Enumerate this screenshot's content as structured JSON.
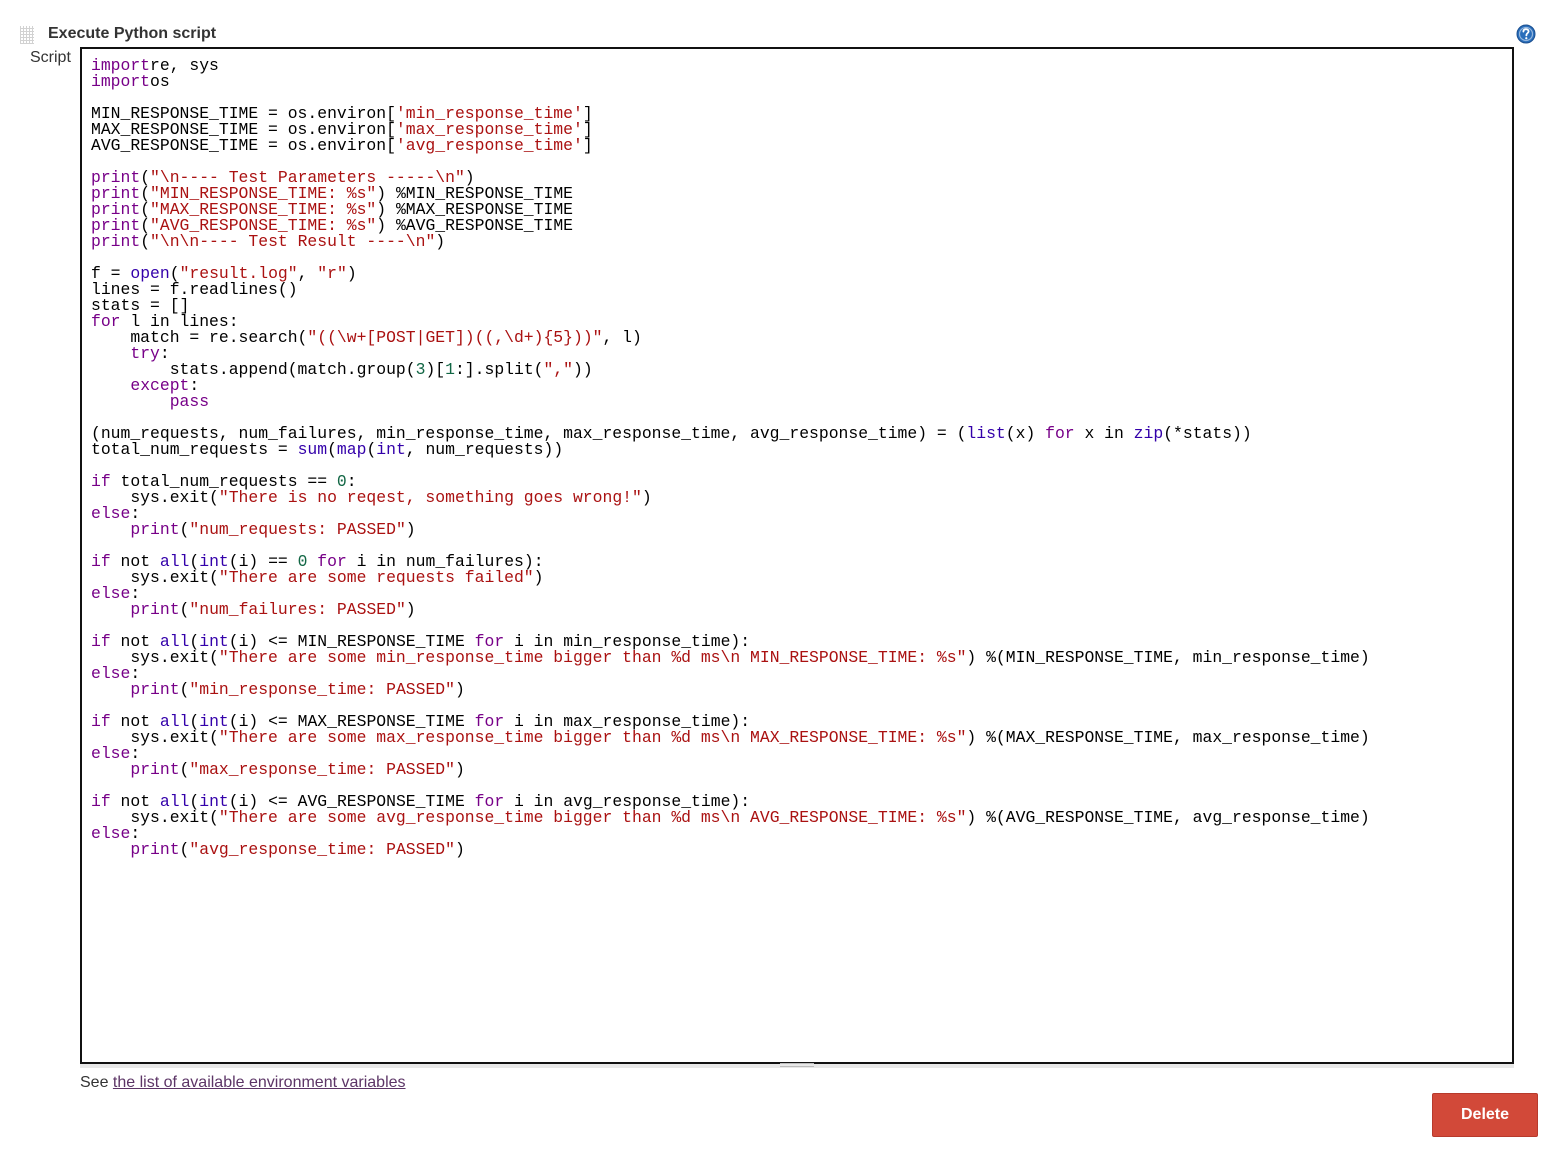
{
  "section": {
    "title": "Execute Python script",
    "help_icon": "question-circle-icon"
  },
  "field": {
    "label": "Script"
  },
  "code": {
    "lines": [
      [
        [
          "kw",
          "import"
        ],
        [
          "",
          "re, sys"
        ]
      ],
      [
        [
          "kw",
          "import"
        ],
        [
          "",
          "os"
        ]
      ],
      [],
      [
        [
          "",
          "MIN_RESPONSE_TIME = os.environ["
        ],
        [
          "str",
          "'min_response_time'"
        ],
        [
          "",
          "]"
        ]
      ],
      [
        [
          "",
          "MAX_RESPONSE_TIME = os.environ["
        ],
        [
          "str",
          "'max_response_time'"
        ],
        [
          "",
          "]"
        ]
      ],
      [
        [
          "",
          "AVG_RESPONSE_TIME = os.environ["
        ],
        [
          "str",
          "'avg_response_time'"
        ],
        [
          "",
          "]"
        ]
      ],
      [],
      [
        [
          "kw",
          "print"
        ],
        [
          "",
          "("
        ],
        [
          "str",
          "\"\\n---- Test Parameters -----\\n\""
        ],
        [
          "",
          ")"
        ]
      ],
      [
        [
          "kw",
          "print"
        ],
        [
          "",
          "("
        ],
        [
          "str",
          "\"MIN_RESPONSE_TIME: %s\""
        ],
        [
          "",
          ") %MIN_RESPONSE_TIME"
        ]
      ],
      [
        [
          "kw",
          "print"
        ],
        [
          "",
          "("
        ],
        [
          "str",
          "\"MAX_RESPONSE_TIME: %s\""
        ],
        [
          "",
          ") %MAX_RESPONSE_TIME"
        ]
      ],
      [
        [
          "kw",
          "print"
        ],
        [
          "",
          "("
        ],
        [
          "str",
          "\"AVG_RESPONSE_TIME: %s\""
        ],
        [
          "",
          ") %AVG_RESPONSE_TIME"
        ]
      ],
      [
        [
          "kw",
          "print"
        ],
        [
          "",
          "("
        ],
        [
          "str",
          "\"\\n\\n---- Test Result ----\\n\""
        ],
        [
          "",
          ")"
        ]
      ],
      [],
      [
        [
          "",
          "f = "
        ],
        [
          "bi",
          "open"
        ],
        [
          "",
          "("
        ],
        [
          "str",
          "\"result.log\""
        ],
        [
          "",
          ", "
        ],
        [
          "str",
          "\"r\""
        ],
        [
          "",
          ")"
        ]
      ],
      [
        [
          "",
          "lines = f.readlines()"
        ]
      ],
      [
        [
          "",
          "stats = []"
        ]
      ],
      [
        [
          "kw",
          "for"
        ],
        [
          "",
          " l in lines:"
        ]
      ],
      [
        [
          "",
          "    match = re.search("
        ],
        [
          "str",
          "\"((\\w+[POST|GET])((,\\d+){5}))\""
        ],
        [
          "",
          ", l)"
        ]
      ],
      [
        [
          "",
          "    "
        ],
        [
          "kw",
          "try"
        ],
        [
          "",
          ":"
        ]
      ],
      [
        [
          "",
          "        stats.append(match.group("
        ],
        [
          "num",
          "3"
        ],
        [
          "",
          ")["
        ],
        [
          "num",
          "1"
        ],
        [
          "",
          ":].split("
        ],
        [
          "str",
          "\",\""
        ],
        [
          "",
          "))"
        ]
      ],
      [
        [
          "",
          "    "
        ],
        [
          "kw",
          "except"
        ],
        [
          "",
          ":"
        ]
      ],
      [
        [
          "",
          "        "
        ],
        [
          "kw",
          "pass"
        ]
      ],
      [],
      [
        [
          "",
          "(num_requests, num_failures, min_response_time, max_response_time, avg_response_time) = ("
        ],
        [
          "bi",
          "list"
        ],
        [
          "",
          "(x) "
        ],
        [
          "kw",
          "for"
        ],
        [
          "",
          " x in "
        ],
        [
          "bi",
          "zip"
        ],
        [
          "",
          "(*stats))"
        ]
      ],
      [
        [
          "",
          "total_num_requests = "
        ],
        [
          "bi",
          "sum"
        ],
        [
          "",
          "("
        ],
        [
          "bi",
          "map"
        ],
        [
          "",
          "("
        ],
        [
          "bi",
          "int"
        ],
        [
          "",
          ", num_requests))"
        ]
      ],
      [],
      [
        [
          "kw",
          "if"
        ],
        [
          "",
          " total_num_requests == "
        ],
        [
          "num",
          "0"
        ],
        [
          "",
          ":"
        ]
      ],
      [
        [
          "",
          "    sys.exit("
        ],
        [
          "str",
          "\"There is no reqest, something goes wrong!\""
        ],
        [
          "",
          ")"
        ]
      ],
      [
        [
          "kw",
          "else"
        ],
        [
          "",
          ":"
        ]
      ],
      [
        [
          "",
          "    "
        ],
        [
          "kw",
          "print"
        ],
        [
          "",
          "("
        ],
        [
          "str",
          "\"num_requests: PASSED\""
        ],
        [
          "",
          ")"
        ]
      ],
      [],
      [
        [
          "kw",
          "if"
        ],
        [
          "",
          " not "
        ],
        [
          "bi",
          "all"
        ],
        [
          "",
          "("
        ],
        [
          "bi",
          "int"
        ],
        [
          "",
          "(i) == "
        ],
        [
          "num",
          "0"
        ],
        [
          "",
          ""
        ],
        [
          "kw",
          " for"
        ],
        [
          "",
          " i in num_failures):"
        ]
      ],
      [
        [
          "",
          "    sys.exit("
        ],
        [
          "str",
          "\"There are some requests failed\""
        ],
        [
          "",
          ")"
        ]
      ],
      [
        [
          "kw",
          "else"
        ],
        [
          "",
          ":"
        ]
      ],
      [
        [
          "",
          "    "
        ],
        [
          "kw",
          "print"
        ],
        [
          "",
          "("
        ],
        [
          "str",
          "\"num_failures: PASSED\""
        ],
        [
          "",
          ")"
        ]
      ],
      [],
      [
        [
          "kw",
          "if"
        ],
        [
          "",
          " not "
        ],
        [
          "bi",
          "all"
        ],
        [
          "",
          "("
        ],
        [
          "bi",
          "int"
        ],
        [
          "",
          "(i) <= MIN_RESPONSE_TIME "
        ],
        [
          "kw",
          "for"
        ],
        [
          "",
          " i in min_response_time):"
        ]
      ],
      [
        [
          "",
          "    sys.exit("
        ],
        [
          "str",
          "\"There are some min_response_time bigger than %d ms\\n MIN_RESPONSE_TIME: %s\""
        ],
        [
          "",
          ") %(MIN_RESPONSE_TIME, min_response_time)"
        ]
      ],
      [
        [
          "kw",
          "else"
        ],
        [
          "",
          ":"
        ]
      ],
      [
        [
          "",
          "    "
        ],
        [
          "kw",
          "print"
        ],
        [
          "",
          "("
        ],
        [
          "str",
          "\"min_response_time: PASSED\""
        ],
        [
          "",
          ")"
        ]
      ],
      [],
      [
        [
          "kw",
          "if"
        ],
        [
          "",
          " not "
        ],
        [
          "bi",
          "all"
        ],
        [
          "",
          "("
        ],
        [
          "bi",
          "int"
        ],
        [
          "",
          "(i) <= MAX_RESPONSE_TIME "
        ],
        [
          "kw",
          "for"
        ],
        [
          "",
          " i in max_response_time):"
        ]
      ],
      [
        [
          "",
          "    sys.exit("
        ],
        [
          "str",
          "\"There are some max_response_time bigger than %d ms\\n MAX_RESPONSE_TIME: %s\""
        ],
        [
          "",
          ") %(MAX_RESPONSE_TIME, max_response_time)"
        ]
      ],
      [
        [
          "kw",
          "else"
        ],
        [
          "",
          ":"
        ]
      ],
      [
        [
          "",
          "    "
        ],
        [
          "kw",
          "print"
        ],
        [
          "",
          "("
        ],
        [
          "str",
          "\"max_response_time: PASSED\""
        ],
        [
          "",
          ")"
        ]
      ],
      [],
      [
        [
          "kw",
          "if"
        ],
        [
          "",
          " not "
        ],
        [
          "bi",
          "all"
        ],
        [
          "",
          "("
        ],
        [
          "bi",
          "int"
        ],
        [
          "",
          "(i) <= AVG_RESPONSE_TIME "
        ],
        [
          "kw",
          "for"
        ],
        [
          "",
          " i in avg_response_time):"
        ]
      ],
      [
        [
          "",
          "    sys.exit("
        ],
        [
          "str",
          "\"There are some avg_response_time bigger than %d ms\\n AVG_RESPONSE_TIME: %s\""
        ],
        [
          "",
          ") %(AVG_RESPONSE_TIME, avg_response_time)"
        ]
      ],
      [
        [
          "kw",
          "else"
        ],
        [
          "",
          ":"
        ]
      ],
      [
        [
          "",
          "    "
        ],
        [
          "kw",
          "print"
        ],
        [
          "",
          "("
        ],
        [
          "str",
          "\"avg_response_time: PASSED\""
        ],
        [
          "",
          ")"
        ]
      ]
    ]
  },
  "footer": {
    "see_prefix": "See ",
    "env_link": "the list of available environment variables"
  },
  "actions": {
    "delete_label": "Delete"
  },
  "colors": {
    "keyword": "#770088",
    "builtin": "#3300aa",
    "string": "#aa1111",
    "number": "#116644",
    "delete_button": "#d24939",
    "link": "#5c3566"
  }
}
